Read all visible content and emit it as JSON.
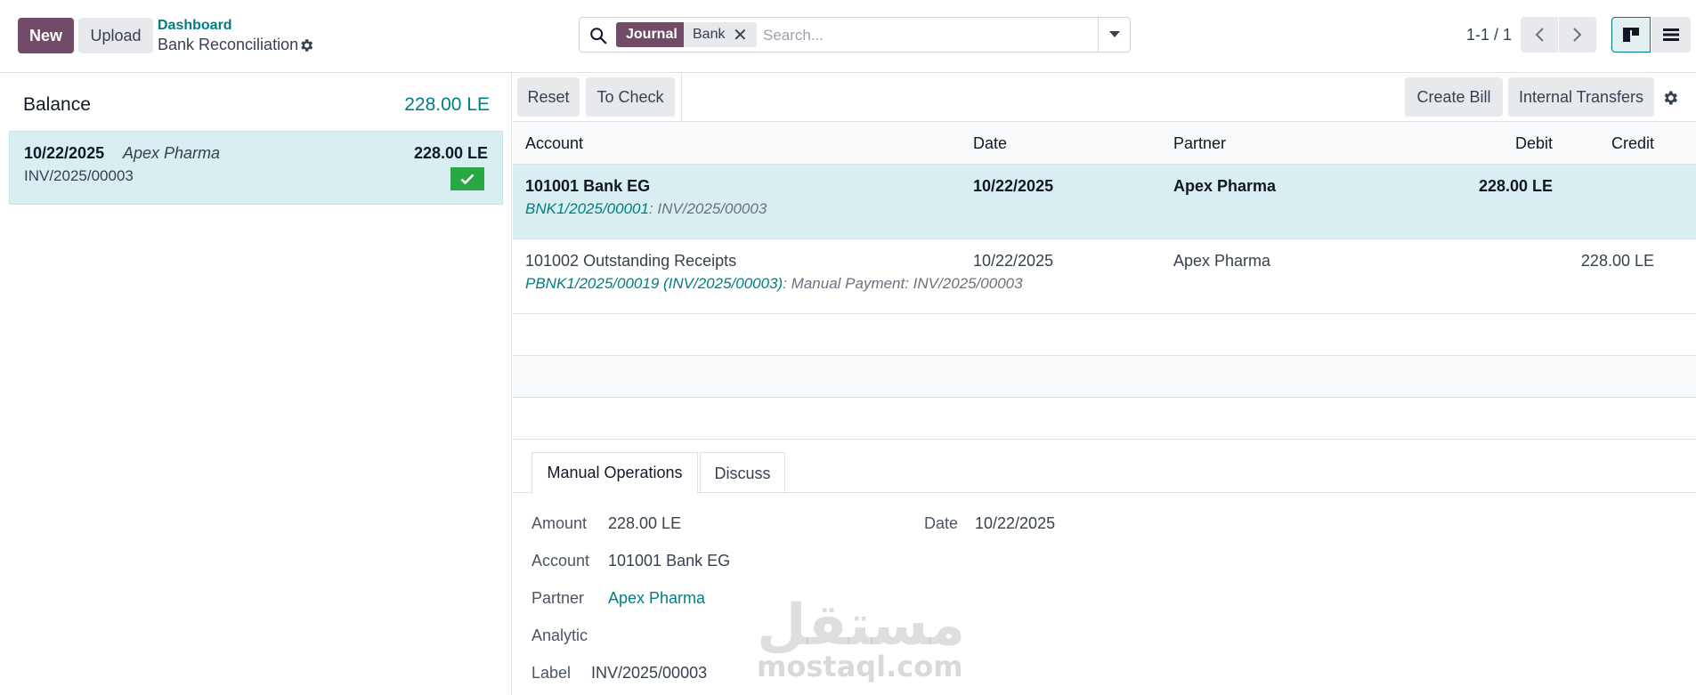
{
  "topbar": {
    "new_label": "New",
    "upload_label": "Upload",
    "breadcrumb_parent": "Dashboard",
    "breadcrumb_current": "Bank Reconciliation",
    "search": {
      "facet_key": "Journal",
      "facet_value": "Bank",
      "placeholder": "Search..."
    },
    "pager": "1-1 / 1"
  },
  "left": {
    "balance_label": "Balance",
    "balance_value": "228.00 LE",
    "statement_line": {
      "date": "10/22/2025",
      "partner": "Apex Pharma",
      "amount": "228.00 LE",
      "ref": "INV/2025/00003"
    }
  },
  "toolbar": {
    "reset": "Reset",
    "to_check": "To Check",
    "create_bill": "Create Bill",
    "internal_transfers": "Internal Transfers"
  },
  "table": {
    "headers": {
      "account": "Account",
      "date": "Date",
      "partner": "Partner",
      "debit": "Debit",
      "credit": "Credit"
    },
    "rows": [
      {
        "account": "101001 Bank EG",
        "date": "10/22/2025",
        "partner": "Apex Pharma",
        "debit": "228.00 LE",
        "credit": "",
        "sub_link": "BNK1/2025/00001",
        "sub_rest": ": INV/2025/00003"
      },
      {
        "account": "101002 Outstanding Receipts",
        "date": "10/22/2025",
        "partner": "Apex Pharma",
        "debit": "",
        "credit": "228.00 LE",
        "sub_link": "PBNK1/2025/00019 (INV/2025/00003)",
        "sub_rest": ": Manual Payment: INV/2025/00003"
      }
    ]
  },
  "tabs": {
    "manual": "Manual Operations",
    "discuss": "Discuss"
  },
  "form": {
    "amount_label": "Amount",
    "amount_value": "228.00 LE",
    "date_label": "Date",
    "date_value": "10/22/2025",
    "account_label": "Account",
    "account_value": "101001 Bank EG",
    "partner_label": "Partner",
    "partner_value": "Apex Pharma",
    "analytic_label": "Analytic",
    "label_label": "Label",
    "label_value": "INV/2025/00003"
  },
  "watermark": {
    "arabic": "مستقل",
    "latin": "mostaql.com"
  },
  "colors": {
    "brand": "#714B67",
    "accent": "#017E84",
    "selected_row": "#d9eef1",
    "success": "#28a745"
  }
}
